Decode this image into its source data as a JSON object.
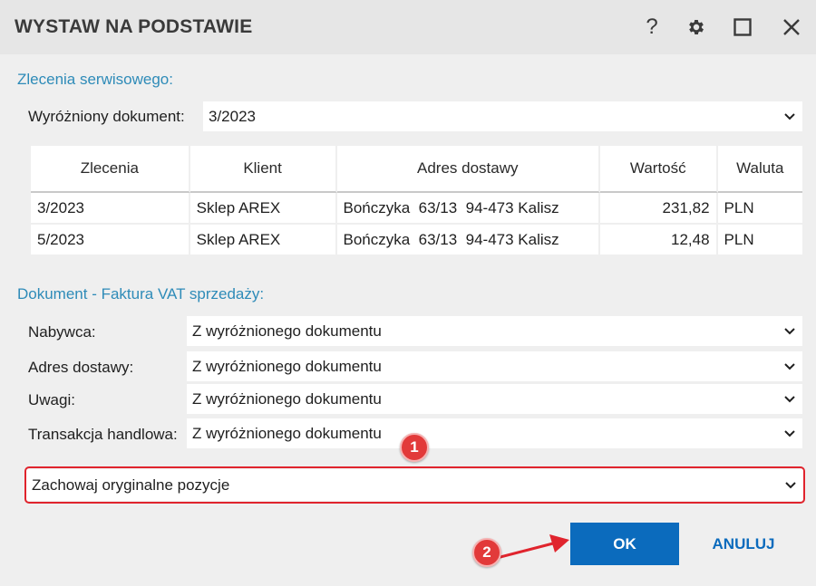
{
  "window": {
    "title": "WYSTAW NA PODSTAWIE",
    "help_icon": "question-mark-icon",
    "settings_icon": "gear-icon",
    "maximize_icon": "square-icon",
    "close_icon": "close-icon"
  },
  "service_orders": {
    "section_label": "Zlecenia serwisowego:",
    "highlighted_label": "Wyróżniony dokument:",
    "highlighted_value": "3/2023",
    "columns": [
      "Zlecenia",
      "Klient",
      "Adres dostawy",
      "Wartość",
      "Waluta"
    ],
    "rows": [
      {
        "order": "3/2023",
        "client": "Sklep AREX",
        "address": "Bończyka  63/13  94-473 Kalisz",
        "value": "231,82",
        "currency": "PLN"
      },
      {
        "order": "5/2023",
        "client": "Sklep AREX",
        "address": "Bończyka  63/13  94-473 Kalisz",
        "value": "12,48",
        "currency": "PLN"
      }
    ]
  },
  "document": {
    "section_label": "Dokument - Faktura VAT sprzedaży:",
    "fields": [
      {
        "label": "Nabywca:",
        "value": "Z wyróżnionego dokumentu"
      },
      {
        "label": "Adres dostawy:",
        "value": "Z wyróżnionego dokumentu"
      },
      {
        "label": "Uwagi:",
        "value": "Z wyróżnionego dokumentu"
      },
      {
        "label": "Transakcja handlowa:",
        "value": "Z wyróżnionego dokumentu"
      }
    ],
    "positions_value": "Zachowaj oryginalne pozycje"
  },
  "annotations": {
    "badge_1": "1",
    "badge_2": "2",
    "color": "#e0242d"
  },
  "actions": {
    "ok_label": "OK",
    "cancel_label": "ANULUJ"
  },
  "colors": {
    "accent": "#0b6bbd",
    "section_label": "#2e8bb8"
  }
}
